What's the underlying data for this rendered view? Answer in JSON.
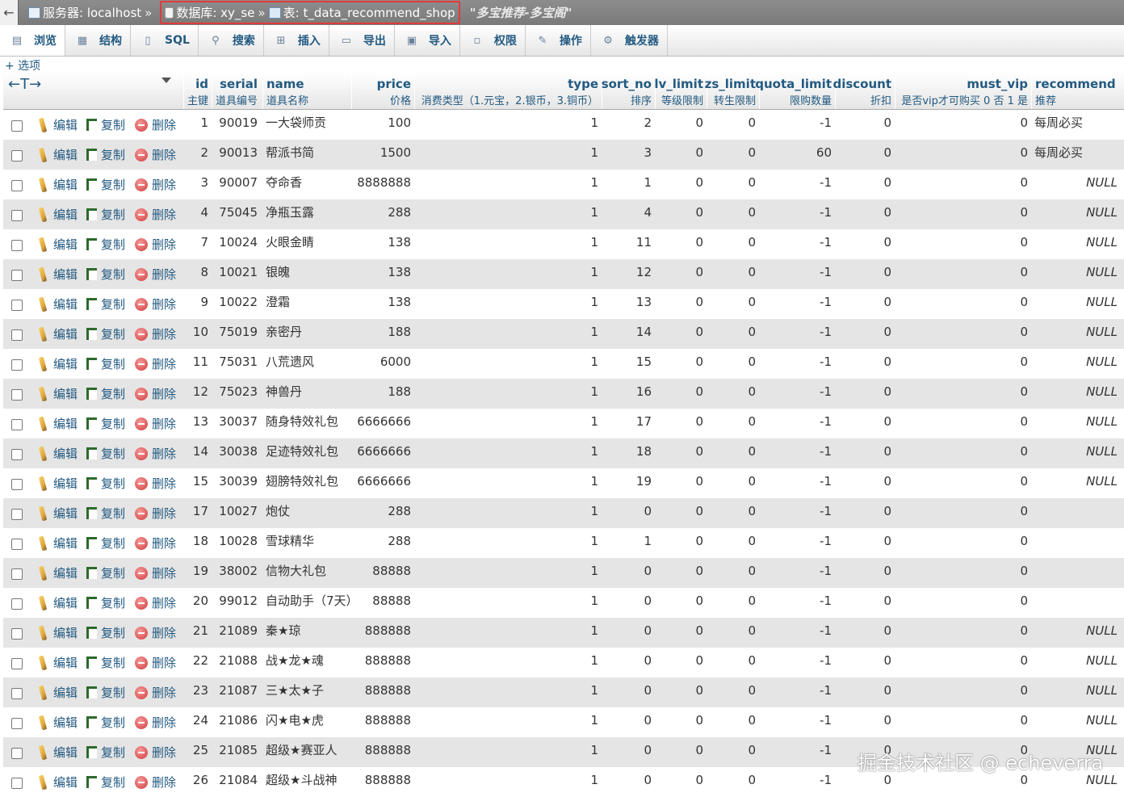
{
  "breadcrumb": {
    "back": "←",
    "server": "服务器: localhost",
    "database": "数据库: xy_se",
    "table": "表: t_data_recommend_shop",
    "comment": "\"多宝推荐-多宝阁\"",
    "sep": "»"
  },
  "tabs": [
    {
      "label": "浏览",
      "icon": "browse-icon",
      "glyph": "▤"
    },
    {
      "label": "结构",
      "icon": "structure-icon",
      "glyph": "▦"
    },
    {
      "label": "SQL",
      "icon": "sql-icon",
      "glyph": "▯"
    },
    {
      "label": "搜索",
      "icon": "search-icon",
      "glyph": "⚲"
    },
    {
      "label": "插入",
      "icon": "insert-icon",
      "glyph": "⊞"
    },
    {
      "label": "导出",
      "icon": "export-icon",
      "glyph": "▭"
    },
    {
      "label": "导入",
      "icon": "import-icon",
      "glyph": "▣"
    },
    {
      "label": "权限",
      "icon": "privileges-icon",
      "glyph": "▫"
    },
    {
      "label": "操作",
      "icon": "operations-icon",
      "glyph": "✎"
    },
    {
      "label": "触发器",
      "icon": "triggers-icon",
      "glyph": "⚙"
    }
  ],
  "options_label": "+ 选项",
  "header_arrows": "←T→",
  "columns": [
    {
      "name": "id",
      "comment": "主键"
    },
    {
      "name": "serial",
      "comment": "道具编号"
    },
    {
      "name": "name",
      "comment": "道具名称"
    },
    {
      "name": "price",
      "comment": "价格"
    },
    {
      "name": "type",
      "comment": "消费类型（1.元宝，2.银币，3.铜币）"
    },
    {
      "name": "sort_no",
      "comment": "排序"
    },
    {
      "name": "lv_limit",
      "comment": "等级限制"
    },
    {
      "name": "zs_limit",
      "comment": "转生限制"
    },
    {
      "name": "quota_limit",
      "comment": "限购数量"
    },
    {
      "name": "discount",
      "comment": "折扣"
    },
    {
      "name": "must_vip",
      "comment": "是否vip才可购买 0 否 1 是"
    },
    {
      "name": "recommend",
      "comment": "推荐"
    }
  ],
  "actions": {
    "edit": "编辑",
    "copy": "复制",
    "delete": "删除"
  },
  "rows": [
    [
      "1",
      "90019",
      "一大袋师贡",
      "100",
      "1",
      "2",
      "0",
      "0",
      "-1",
      "0",
      "0",
      "每周必买"
    ],
    [
      "2",
      "90013",
      "帮派书简",
      "1500",
      "1",
      "3",
      "0",
      "0",
      "60",
      "0",
      "0",
      "每周必买"
    ],
    [
      "3",
      "90007",
      "夺命香",
      "8888888",
      "1",
      "1",
      "0",
      "0",
      "-1",
      "0",
      "0",
      "NULL"
    ],
    [
      "4",
      "75045",
      "净瓶玉露",
      "288",
      "1",
      "4",
      "0",
      "0",
      "-1",
      "0",
      "0",
      "NULL"
    ],
    [
      "7",
      "10024",
      "火眼金睛",
      "138",
      "1",
      "11",
      "0",
      "0",
      "-1",
      "0",
      "0",
      "NULL"
    ],
    [
      "8",
      "10021",
      "银魄",
      "138",
      "1",
      "12",
      "0",
      "0",
      "-1",
      "0",
      "0",
      "NULL"
    ],
    [
      "9",
      "10022",
      "澄霜",
      "138",
      "1",
      "13",
      "0",
      "0",
      "-1",
      "0",
      "0",
      "NULL"
    ],
    [
      "10",
      "75019",
      "亲密丹",
      "188",
      "1",
      "14",
      "0",
      "0",
      "-1",
      "0",
      "0",
      "NULL"
    ],
    [
      "11",
      "75031",
      "八荒遗风",
      "6000",
      "1",
      "15",
      "0",
      "0",
      "-1",
      "0",
      "0",
      "NULL"
    ],
    [
      "12",
      "75023",
      "神兽丹",
      "188",
      "1",
      "16",
      "0",
      "0",
      "-1",
      "0",
      "0",
      "NULL"
    ],
    [
      "13",
      "30037",
      "随身特效礼包",
      "6666666",
      "1",
      "17",
      "0",
      "0",
      "-1",
      "0",
      "0",
      "NULL"
    ],
    [
      "14",
      "30038",
      "足迹特效礼包",
      "6666666",
      "1",
      "18",
      "0",
      "0",
      "-1",
      "0",
      "0",
      "NULL"
    ],
    [
      "15",
      "30039",
      "翅膀特效礼包",
      "6666666",
      "1",
      "19",
      "0",
      "0",
      "-1",
      "0",
      "0",
      "NULL"
    ],
    [
      "17",
      "10027",
      "炮仗",
      "288",
      "1",
      "0",
      "0",
      "0",
      "-1",
      "0",
      "0",
      ""
    ],
    [
      "18",
      "10028",
      "雪球精华",
      "288",
      "1",
      "1",
      "0",
      "0",
      "-1",
      "0",
      "0",
      ""
    ],
    [
      "19",
      "38002",
      "信物大礼包",
      "88888",
      "1",
      "0",
      "0",
      "0",
      "-1",
      "0",
      "0",
      ""
    ],
    [
      "20",
      "99012",
      "自动助手（7天）",
      "88888",
      "1",
      "0",
      "0",
      "0",
      "-1",
      "0",
      "0",
      ""
    ],
    [
      "21",
      "21089",
      "秦★琼",
      "888888",
      "1",
      "0",
      "0",
      "0",
      "-1",
      "0",
      "0",
      "NULL"
    ],
    [
      "22",
      "21088",
      "战★龙★魂",
      "888888",
      "1",
      "0",
      "0",
      "0",
      "-1",
      "0",
      "0",
      "NULL"
    ],
    [
      "23",
      "21087",
      "三★太★子",
      "888888",
      "1",
      "0",
      "0",
      "0",
      "-1",
      "0",
      "0",
      "NULL"
    ],
    [
      "24",
      "21086",
      "闪★电★虎",
      "888888",
      "1",
      "0",
      "0",
      "0",
      "-1",
      "0",
      "0",
      "NULL"
    ],
    [
      "25",
      "21085",
      "超级★赛亚人",
      "888888",
      "1",
      "0",
      "0",
      "0",
      "-1",
      "0",
      "0",
      "NULL"
    ],
    [
      "26",
      "21084",
      "超级★斗战神",
      "888888",
      "1",
      "0",
      "0",
      "0",
      "-1",
      "0",
      "0",
      "NULL"
    ]
  ],
  "watermark": "掘金技术社区 @ echeverra"
}
